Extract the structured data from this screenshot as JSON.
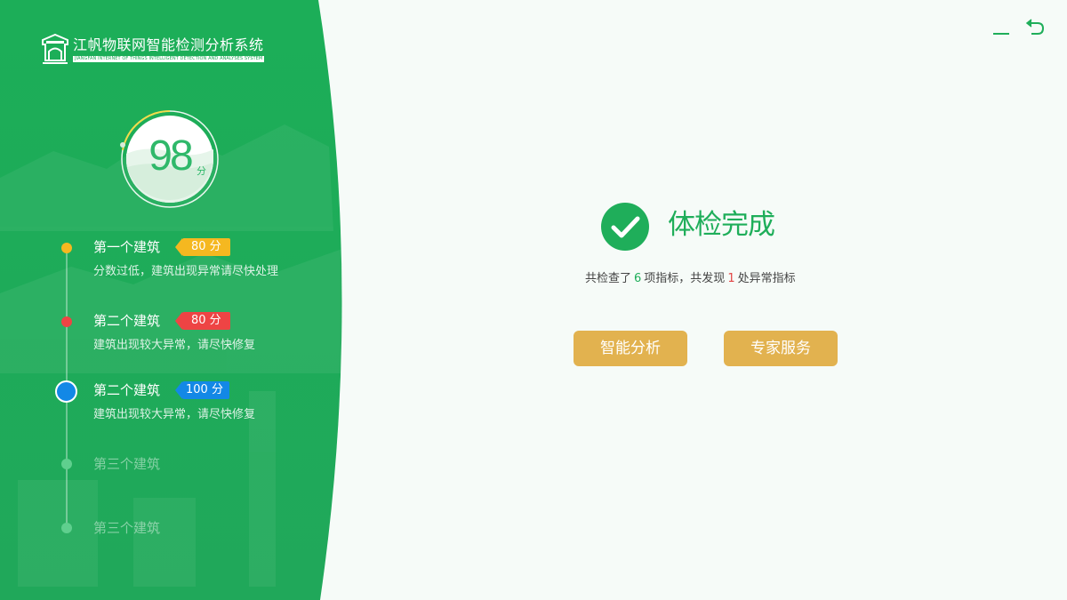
{
  "brand": {
    "title": "江帆物联网智能检测分析系统",
    "subtitle": "JIANGFAN INTERNET OF THINGS INTELLIGENT DETECTION AND ANALYSES SYSTEM"
  },
  "score": {
    "value": "98",
    "unit": "分"
  },
  "timeline": [
    {
      "title": "第一个建筑",
      "badge": "80 分",
      "badge_color": "#f5b820",
      "dot_color": "#f5b820",
      "desc": "分数过低，建筑出现异常请尽快处理"
    },
    {
      "title": "第二个建筑",
      "badge": "80 分",
      "badge_color": "#ee4444",
      "dot_color": "#ee4444",
      "desc": "建筑出现较大异常，请尽快修复"
    },
    {
      "title": "第二个建筑",
      "badge": "100 分",
      "badge_color": "#1388e6",
      "dot_color": "#1388e6",
      "desc": "建筑出现较大异常，请尽快修复"
    },
    {
      "title": "第三个建筑"
    },
    {
      "title": "第三个建筑"
    }
  ],
  "result": {
    "title": "体检完成",
    "summary_prefix": "共检查了",
    "checked_count": "6",
    "summary_middle": "项指标，共发现",
    "abnormal_count": "1",
    "summary_suffix": "处异常指标"
  },
  "buttons": {
    "analysis": "智能分析",
    "expert": "专家服务"
  },
  "colors": {
    "primary_green": "#1fae5a",
    "button_gold": "#e2b24f",
    "background": "#f6fbf8"
  },
  "icons": {
    "minimize": "minimize-icon",
    "back": "back-arrow-icon",
    "check": "check-circle-icon",
    "logo": "castle-logo-icon"
  }
}
